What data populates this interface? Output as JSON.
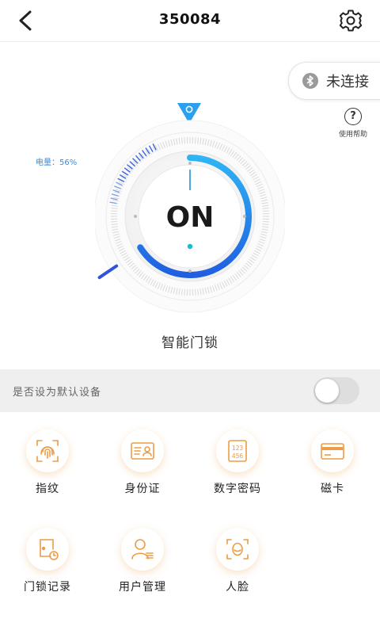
{
  "header": {
    "title": "350084"
  },
  "bluetooth": {
    "status": "未连接"
  },
  "help": {
    "label": "使用帮助"
  },
  "battery": {
    "label": "电量：56%",
    "level_percent": 56
  },
  "lock": {
    "state": "ON",
    "name": "智能门锁"
  },
  "default_device": {
    "label": "是否设为默认设备",
    "enabled": false
  },
  "functions": [
    {
      "label": "指纹",
      "icon": "fingerprint-icon"
    },
    {
      "label": "身份证",
      "icon": "id-card-icon"
    },
    {
      "label": "数字密码",
      "icon": "number-password-icon"
    },
    {
      "label": "磁卡",
      "icon": "magnetic-card-icon"
    },
    {
      "label": "门锁记录",
      "icon": "lock-record-icon"
    },
    {
      "label": "用户管理",
      "icon": "user-management-icon"
    },
    {
      "label": "人脸",
      "icon": "face-icon"
    }
  ],
  "colors": {
    "accent_blue": "#2f8ef0",
    "accent_orange": "#f0a24a",
    "battery_text": "#3a8ddf"
  }
}
